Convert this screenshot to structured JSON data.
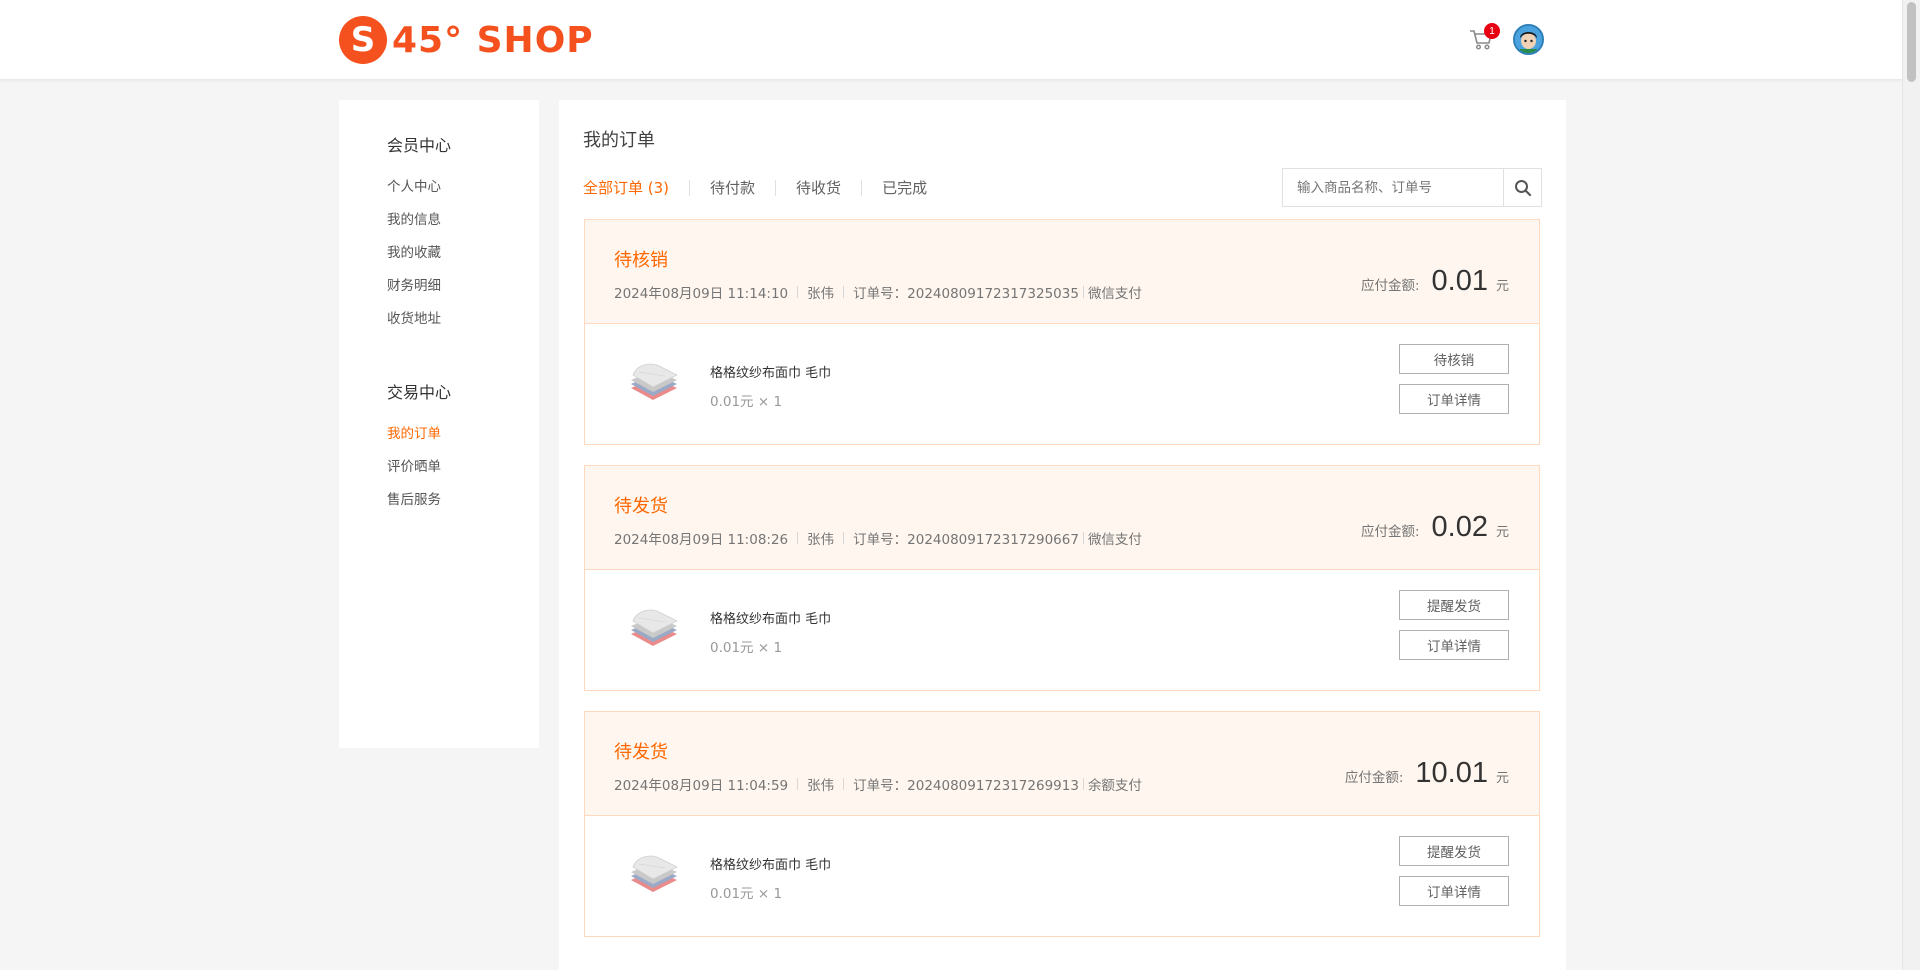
{
  "header": {
    "logo_letter": "S",
    "logo_text": "45° SHOP",
    "cart_count": "1"
  },
  "sidebar": {
    "groups": [
      {
        "title": "会员中心",
        "items": [
          "个人中心",
          "我的信息",
          "我的收藏",
          "财务明细",
          "收货地址"
        ]
      },
      {
        "title": "交易中心",
        "items": [
          "我的订单",
          "评价晒单",
          "售后服务"
        ]
      }
    ],
    "active_item": "我的订单"
  },
  "main": {
    "title": "我的订单",
    "tabs": [
      "全部订单 (3)",
      "待付款",
      "待收货",
      "已完成"
    ],
    "active_tab": "全部订单 (3)",
    "search_placeholder": "输入商品名称、订单号"
  },
  "orders": [
    {
      "status": "待核销",
      "datetime": "2024年08月09日 11:14:10",
      "customer": "张伟",
      "order_no_label": "订单号：20240809172317325035",
      "payment": "微信支付",
      "amount_label": "应付金额:",
      "amount": "0.01",
      "amount_unit": "元",
      "goods_name": "格格纹纱布面巾 毛巾",
      "goods_price": "0.01元 × 1",
      "action_primary": "待核销",
      "action_detail": "订单详情"
    },
    {
      "status": "待发货",
      "datetime": "2024年08月09日 11:08:26",
      "customer": "张伟",
      "order_no_label": "订单号：20240809172317290667",
      "payment": "微信支付",
      "amount_label": "应付金额:",
      "amount": "0.02",
      "amount_unit": "元",
      "goods_name": "格格纹纱布面巾 毛巾",
      "goods_price": "0.01元 × 1",
      "action_primary": "提醒发货",
      "action_detail": "订单详情"
    },
    {
      "status": "待发货",
      "datetime": "2024年08月09日 11:04:59",
      "customer": "张伟",
      "order_no_label": "订单号：20240809172317269913",
      "payment": "余额支付",
      "amount_label": "应付金额:",
      "amount": "10.01",
      "amount_unit": "元",
      "goods_name": "格格纹纱布面巾 毛巾",
      "goods_price": "0.01元 × 1",
      "action_primary": "提醒发货",
      "action_detail": "订单详情"
    }
  ],
  "colors": {
    "brand": "#f5511e",
    "accent": "#ff6700",
    "order_head_bg": "#fff6ef",
    "order_border": "#ffd9bd"
  },
  "icons": [
    "cart-icon",
    "avatar",
    "search-icon",
    "towel-thumbnail"
  ]
}
